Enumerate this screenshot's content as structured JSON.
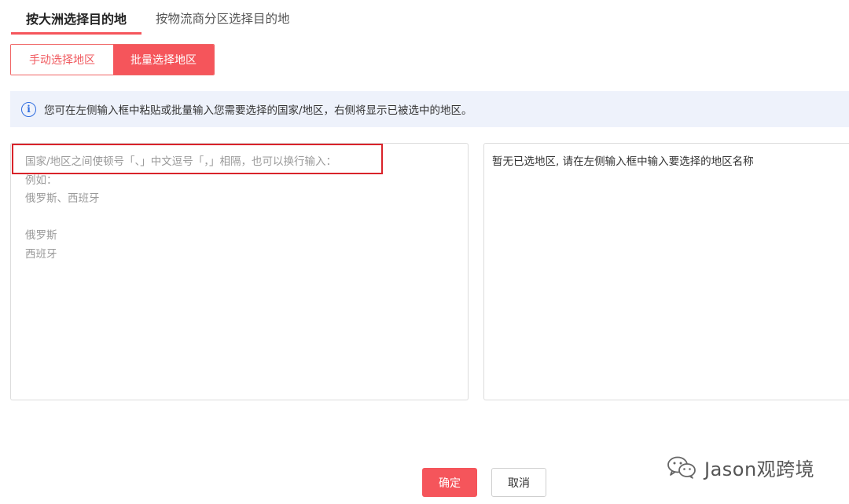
{
  "tabs": [
    {
      "label": "按大洲选择目的地",
      "active": true
    },
    {
      "label": "按物流商分区选择目的地",
      "active": false
    }
  ],
  "mode_toggle": {
    "manual_label": "手动选择地区",
    "batch_label": "批量选择地区",
    "active": "batch"
  },
  "info": {
    "icon": "info-icon",
    "text": "您可在左侧输入框中粘贴或批量输入您需要选择的国家/地区，右侧将显示已被选中的地区。"
  },
  "left_panel": {
    "placeholder_lines": [
      "国家/地区之间使顿号「、」中文逗号「，」相隔，也可以换行输入：",
      "例如：",
      "俄罗斯、西班牙",
      "",
      "俄罗斯",
      "西班牙"
    ]
  },
  "right_panel": {
    "empty_text": "暂无已选地区, 请在左侧输入框中输入要选择的地区名称"
  },
  "buttons": {
    "confirm": "确定",
    "cancel": "取消"
  },
  "watermark": {
    "icon": "wechat-icon",
    "text": "Jason观跨境"
  },
  "colors": {
    "accent": "#f5555b",
    "highlight": "#d9232a",
    "info_bg": "#eef2fb",
    "info_icon": "#2f6de0"
  }
}
